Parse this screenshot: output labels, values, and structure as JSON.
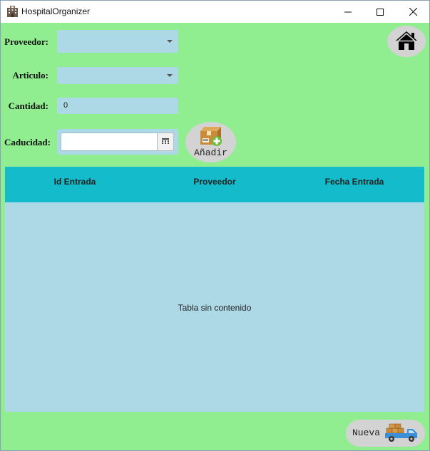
{
  "window": {
    "title": "HospitalOrganizer",
    "app_icon": "hospital-building-icon",
    "controls": [
      "minimize-icon",
      "maximize-icon",
      "close-icon"
    ]
  },
  "form": {
    "proveedor_label": "Proveedor:",
    "proveedor_value": "",
    "articulo_label": "Articulo:",
    "articulo_value": "",
    "cantidad_label": "Cantidad:",
    "cantidad_value": "0",
    "caducidad_label": "Caducidad:",
    "caducidad_value": "",
    "calendar_icon": "calendar-icon"
  },
  "buttons": {
    "home_icon": "home-icon",
    "anadir_label": "Añadir",
    "anadir_icon": "add-package-icon",
    "nueva_label": "Nueva",
    "nueva_icon": "delivery-truck-icon"
  },
  "table": {
    "columns": [
      "Id Entrada",
      "Proveedor",
      "Fecha Entrada"
    ],
    "rows": [],
    "empty_message": "Tabla sin contenido"
  },
  "colors": {
    "background": "#90ee90",
    "input_background": "#add8e6",
    "table_header": "#14bccb",
    "button_background": "#d3d3d3"
  }
}
